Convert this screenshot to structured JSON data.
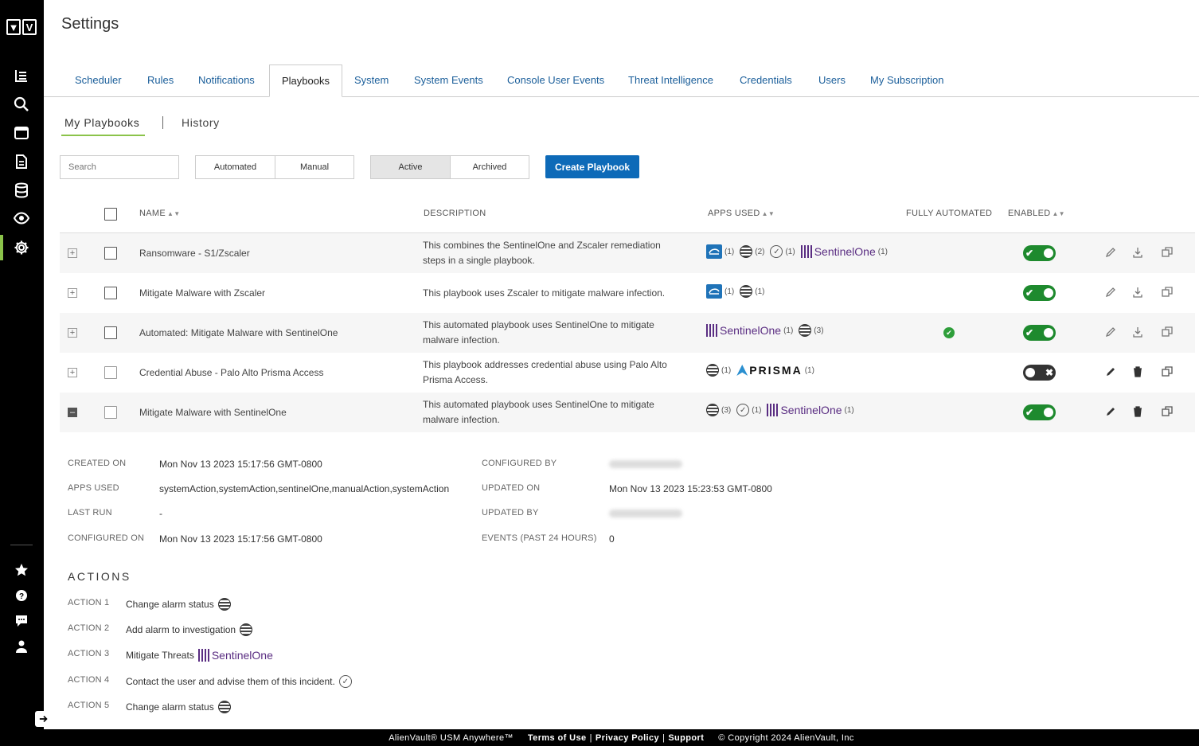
{
  "page_title": "Settings",
  "logo": [
    "▼",
    "V"
  ],
  "sidebar": {
    "items": [
      {
        "icon": "dashboard-icon"
      },
      {
        "icon": "search-icon"
      },
      {
        "icon": "window-icon"
      },
      {
        "icon": "document-icon"
      },
      {
        "icon": "database-icon"
      },
      {
        "icon": "eye-icon"
      },
      {
        "icon": "gear-icon"
      },
      {
        "icon": "star-icon"
      },
      {
        "icon": "help-icon"
      },
      {
        "icon": "chat-icon"
      },
      {
        "icon": "user-icon"
      }
    ],
    "expand_icon": "arrow-right-icon"
  },
  "tabs": [
    "Scheduler",
    "Rules",
    "Notifications",
    "Playbooks",
    "System",
    "System Events",
    "Console User Events",
    "Threat Intelligence",
    "Credentials",
    "Users",
    "My Subscription"
  ],
  "active_tab": "Playbooks",
  "subtabs": [
    "My Playbooks",
    "History"
  ],
  "search": {
    "placeholder": "Search"
  },
  "filters": {
    "automated": "Automated",
    "manual": "Manual",
    "active": "Active",
    "archived": "Archived"
  },
  "create_button": "Create Playbook",
  "columns": {
    "name": "NAME",
    "description": "DESCRIPTION",
    "apps_used": "APPS USED",
    "fully_automated": "FULLY AUTOMATED",
    "enabled": "ENABLED"
  },
  "rows": [
    {
      "name": "Ransomware - S1/Zscaler",
      "description": "This combines the SentinelOne and Zscaler remediation steps in a single playbook.",
      "apps": [
        {
          "app": "zscaler",
          "count": "(1)"
        },
        {
          "app": "system",
          "count": "(2)"
        },
        {
          "app": "manual",
          "count": "(1)"
        },
        {
          "app": "sentinelone",
          "count": "(1)"
        }
      ],
      "fully_automated": false,
      "enabled": true
    },
    {
      "name": "Mitigate Malware with Zscaler",
      "description": "This playbook uses Zscaler to mitigate malware infection.",
      "apps": [
        {
          "app": "zscaler",
          "count": "(1)"
        },
        {
          "app": "system",
          "count": "(1)"
        }
      ],
      "fully_automated": false,
      "enabled": true
    },
    {
      "name": "Automated: Mitigate Malware with SentinelOne",
      "description": "This automated playbook uses SentinelOne to mitigate malware infection.",
      "apps": [
        {
          "app": "sentinelone",
          "count": "(1)"
        },
        {
          "app": "system",
          "count": "(3)"
        }
      ],
      "fully_automated": true,
      "enabled": true
    },
    {
      "name": "Credential Abuse - Palo Alto Prisma Access",
      "description": "This playbook addresses credential abuse using Palo Alto Prisma Access.",
      "apps": [
        {
          "app": "system",
          "count": "(1)"
        },
        {
          "app": "prisma",
          "count": "(1)"
        }
      ],
      "fully_automated": false,
      "enabled": false
    },
    {
      "name": "Mitigate Malware with SentinelOne",
      "description": "This automated playbook uses SentinelOne to mitigate malware infection.",
      "apps": [
        {
          "app": "system",
          "count": "(3)"
        },
        {
          "app": "manual",
          "count": "(1)"
        },
        {
          "app": "sentinelone",
          "count": "(1)"
        }
      ],
      "fully_automated": false,
      "enabled": true
    }
  ],
  "app_labels": {
    "sentinelone": "SentinelOne",
    "prisma": "PRISMA"
  },
  "details": {
    "created_on_label": "CREATED ON",
    "created_on": "Mon Nov 13 2023 15:17:56 GMT-0800",
    "apps_used_label": "APPS USED",
    "apps_used": "systemAction,systemAction,sentinelOne,manualAction,systemAction",
    "last_run_label": "LAST RUN",
    "last_run": "-",
    "configured_on_label": "CONFIGURED ON",
    "configured_on": "Mon Nov 13 2023 15:17:56 GMT-0800",
    "configured_by_label": "CONFIGURED BY",
    "updated_on_label": "UPDATED ON",
    "updated_on": "Mon Nov 13 2023 15:23:53 GMT-0800",
    "updated_by_label": "UPDATED BY",
    "events_label": "EVENTS (PAST 24 HOURS)",
    "events": "0"
  },
  "actions_heading": "ACTIONS",
  "actions": [
    {
      "label": "ACTION 1",
      "text": "Change alarm status",
      "app": "system"
    },
    {
      "label": "ACTION 2",
      "text": "Add alarm to investigation",
      "app": "system"
    },
    {
      "label": "ACTION 3",
      "text": "Mitigate Threats",
      "app": "sentinelone"
    },
    {
      "label": "ACTION 4",
      "text": "Contact the user and advise them of this incident.",
      "app": "manual"
    },
    {
      "label": "ACTION 5",
      "text": "Change alarm status",
      "app": "system"
    }
  ],
  "footer": {
    "product": "AlienVault® USM Anywhere™",
    "terms": "Terms of Use",
    "sep": "|",
    "privacy": "Privacy Policy",
    "support": "Support",
    "copyright": "© Copyright 2024 AlienVault, Inc"
  },
  "colors": {
    "accent_green": "#8bc34a",
    "primary_blue": "#0d6ab8",
    "link_blue": "#1a5e9a",
    "toggle_on": "#1e8a2e"
  }
}
